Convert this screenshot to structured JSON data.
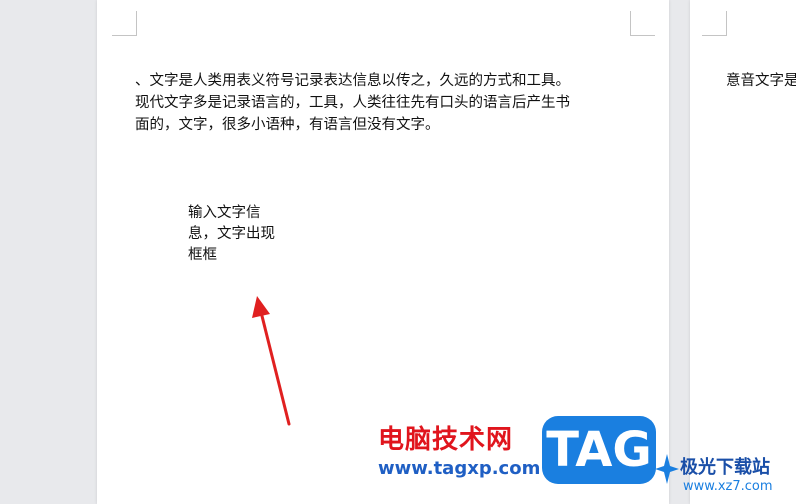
{
  "document": {
    "page1": {
      "paragraph": "、文字是人类用表义符号记录表达信息以传之，久远的方式和工具。\n现代文字多是记录语言的，工具，人类往往先有口头的语言后产生书\n面的，文字，很多小语种，有语言但没有文字。",
      "textbox": "输入文字信\n息，文字出现\n框框"
    },
    "page2": {
      "paragraph_fragment": "意音文字是"
    }
  },
  "annotation": {
    "arrow_color": "#e02020"
  },
  "watermark": {
    "site_name_cn": "电脑技术网",
    "site_url": "www.tagxp.com",
    "logo_text": "TAG",
    "logo_color": "#1a7fe0",
    "second_site_cn": "极光下载站",
    "second_site_url": "www.xz7.com"
  }
}
